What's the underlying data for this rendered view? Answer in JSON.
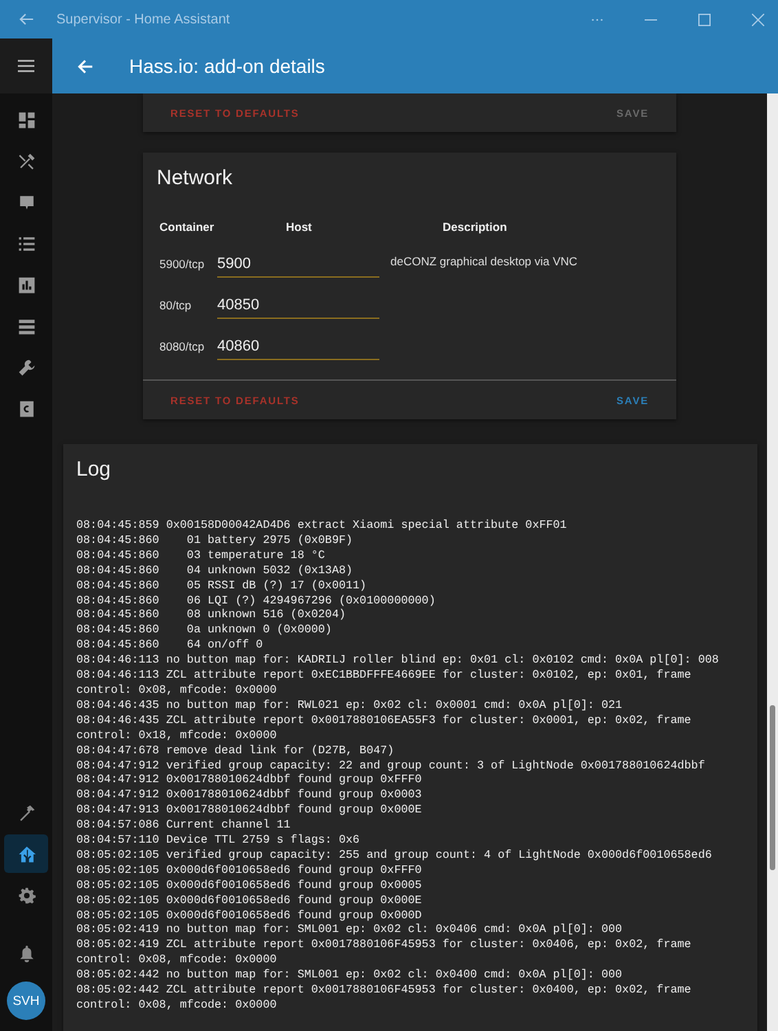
{
  "titlebar": {
    "title": "Supervisor - Home Assistant"
  },
  "header": {
    "title": "Hass.io: add-on details"
  },
  "sidebar": {
    "items": [
      {
        "kind": "dashboard",
        "selected": false
      },
      {
        "kind": "tools",
        "selected": false
      },
      {
        "kind": "badge",
        "selected": false
      },
      {
        "kind": "list",
        "selected": false
      },
      {
        "kind": "chart",
        "selected": false
      },
      {
        "kind": "stack",
        "selected": false
      },
      {
        "kind": "wrench",
        "selected": false
      },
      {
        "kind": "letter",
        "selected": false
      }
    ],
    "bottom_items": [
      {
        "kind": "hammer",
        "selected": false
      },
      {
        "kind": "home",
        "selected": true
      },
      {
        "kind": "gear",
        "selected": false
      }
    ],
    "avatar": "SVH"
  },
  "previous_card": {
    "reset": "RESET TO DEFAULTS",
    "save": "SAVE",
    "save_disabled": true
  },
  "network": {
    "title": "Network",
    "columns": [
      "Container",
      "Host",
      "Description"
    ],
    "ports": [
      {
        "container": "5900/tcp",
        "host": "5900",
        "description": "deCONZ graphical desktop via VNC"
      },
      {
        "container": "80/tcp",
        "host": "40850"
      },
      {
        "container": "8080/tcp",
        "host": "40860"
      }
    ],
    "reset": "RESET TO DEFAULTS",
    "save": "SAVE",
    "save_disabled": false
  },
  "log": {
    "title": "Log",
    "lines": [
      "08:04:45:859 0x00158D00042AD4D6 extract Xiaomi special attribute 0xFF01",
      "08:04:45:860    01 battery 2975 (0x0B9F)",
      "08:04:45:860    03 temperature 18 °C",
      "08:04:45:860    04 unknown 5032 (0x13A8)",
      "08:04:45:860    05 RSSI dB (?) 17 (0x0011)",
      "08:04:45:860    06 LQI (?) 4294967296 (0x0100000000)",
      "08:04:45:860    08 unknown 516 (0x0204)",
      "08:04:45:860    0a unknown 0 (0x0000)",
      "08:04:45:860    64 on/off 0",
      "08:04:46:113 no button map for: KADRILJ roller blind ep: 0x01 cl: 0x0102 cmd: 0x0A pl[0]: 008",
      "08:04:46:113 ZCL attribute report 0xEC1BBDFFFE4669EE for cluster: 0x0102, ep: 0x01, frame control: 0x08, mfcode: 0x0000",
      "08:04:46:435 no button map for: RWL021 ep: 0x02 cl: 0x0001 cmd: 0x0A pl[0]: 021",
      "08:04:46:435 ZCL attribute report 0x0017880106EA55F3 for cluster: 0x0001, ep: 0x02, frame control: 0x18, mfcode: 0x0000",
      "08:04:47:678 remove dead link for (D27B, B047)",
      "08:04:47:912 verified group capacity: 22 and group count: 3 of LightNode 0x001788010624dbbf",
      "08:04:47:912 0x001788010624dbbf found group 0xFFF0",
      "08:04:47:912 0x001788010624dbbf found group 0x0003",
      "08:04:47:913 0x001788010624dbbf found group 0x000E",
      "08:04:57:086 Current channel 11",
      "08:04:57:110 Device TTL 2759 s flags: 0x6",
      "08:05:02:105 verified group capacity: 255 and group count: 4 of LightNode 0x000d6f0010658ed6",
      "08:05:02:105 0x000d6f0010658ed6 found group 0xFFF0",
      "08:05:02:105 0x000d6f0010658ed6 found group 0x0005",
      "08:05:02:105 0x000d6f0010658ed6 found group 0x000E",
      "08:05:02:105 0x000d6f0010658ed6 found group 0x000D",
      "08:05:02:419 no button map for: SML001 ep: 0x02 cl: 0x0406 cmd: 0x0A pl[0]: 000",
      "08:05:02:419 ZCL attribute report 0x0017880106F45953 for cluster: 0x0406, ep: 0x02, frame control: 0x08, mfcode: 0x0000",
      "08:05:02:442 no button map for: SML001 ep: 0x02 cl: 0x0400 cmd: 0x0A pl[0]: 000",
      "08:05:02:442 ZCL attribute report 0x0017880106F45953 for cluster: 0x0400, ep: 0x02, frame control: 0x08, mfcode: 0x0000"
    ]
  }
}
